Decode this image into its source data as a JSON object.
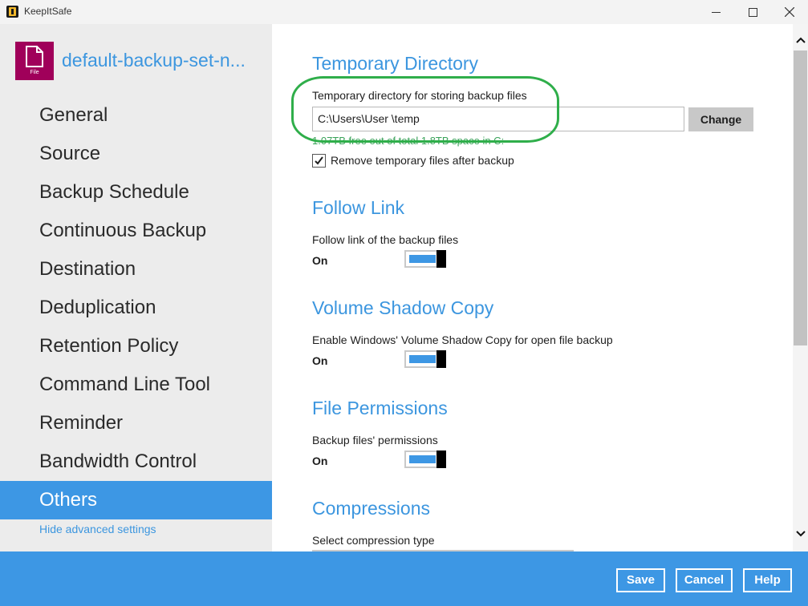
{
  "window": {
    "title": "KeepItSafe",
    "minimize": "—",
    "maximize": "☐",
    "close": "✕"
  },
  "sidebar": {
    "file_icon_label": "File",
    "backup_set_name": "default-backup-set-n...",
    "items": [
      {
        "label": "General"
      },
      {
        "label": "Source"
      },
      {
        "label": "Backup Schedule"
      },
      {
        "label": "Continuous Backup"
      },
      {
        "label": "Destination"
      },
      {
        "label": "Deduplication"
      },
      {
        "label": "Retention Policy"
      },
      {
        "label": "Command Line Tool"
      },
      {
        "label": "Reminder"
      },
      {
        "label": "Bandwidth Control"
      },
      {
        "label": "Others"
      }
    ],
    "active_item": "Others",
    "hide_advanced_label": "Hide advanced settings"
  },
  "main": {
    "temp_dir": {
      "title": "Temporary Directory",
      "label": "Temporary directory for storing backup files",
      "path_value": "C:\\Users\\User  \\temp",
      "change_label": "Change",
      "free_space": "1.07TB free out of total 1.8TB space in C:",
      "remove_checked": true,
      "remove_label": "Remove temporary files after backup"
    },
    "follow_link": {
      "title": "Follow Link",
      "label": "Follow link of the backup files",
      "state": "On"
    },
    "vss": {
      "title": "Volume Shadow Copy",
      "label": "Enable Windows' Volume Shadow Copy for open file backup",
      "state": "On"
    },
    "file_permissions": {
      "title": "File Permissions",
      "label": "Backup files' permissions",
      "state": "On"
    },
    "compressions": {
      "title": "Compressions",
      "label": "Select compression type"
    }
  },
  "footer": {
    "save": "Save",
    "cancel": "Cancel",
    "help": "Help"
  },
  "colors": {
    "accent": "#3d97e4",
    "brand_file": "#a0005a",
    "highlight": "#2fae4a",
    "free_space": "#3aa35a"
  }
}
